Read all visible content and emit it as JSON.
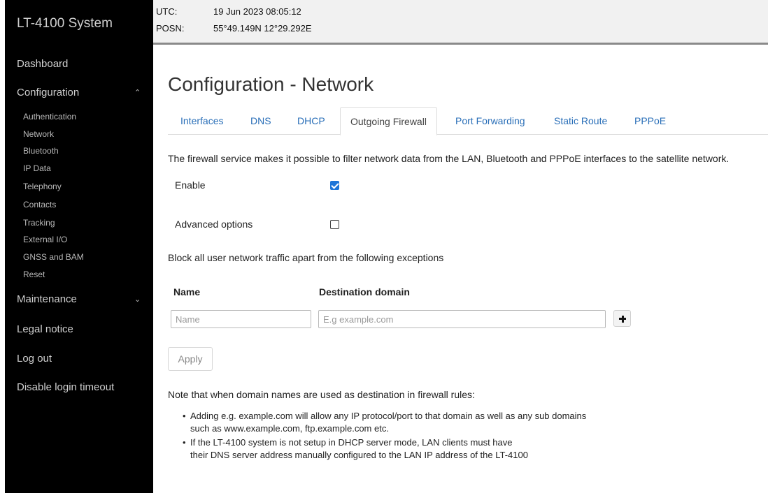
{
  "sidebar": {
    "brand": "LT-4100 System",
    "dashboard": "Dashboard",
    "configuration": "Configuration",
    "config_items": [
      "Authentication",
      "Network",
      "Bluetooth",
      "IP Data",
      "Telephony",
      "Contacts",
      "Tracking",
      "External I/O",
      "GNSS and BAM",
      "Reset"
    ],
    "maintenance": "Maintenance",
    "legal": "Legal notice",
    "logout": "Log out",
    "disable_timeout": "Disable login timeout"
  },
  "status": {
    "utc_label": "UTC:",
    "utc_value": "19 Jun 2023 08:05:12",
    "posn_label": "POSN:",
    "posn_value": "55°49.149N 12°29.292E"
  },
  "main": {
    "title": "Configuration - Network",
    "tabs": [
      "Interfaces",
      "DNS",
      "DHCP",
      "Outgoing Firewall",
      "Port Forwarding",
      "Static Route",
      "PPPoE"
    ],
    "active_tab": "Outgoing Firewall",
    "description": "The firewall service makes it possible to filter network data from the LAN, Bluetooth and PPPoE interfaces to the satellite network.",
    "enable_label": "Enable",
    "enable_checked": true,
    "advanced_label": "Advanced options",
    "advanced_checked": false,
    "block_text": "Block all user network traffic apart from the following exceptions",
    "col_name": "Name",
    "col_destination": "Destination domain",
    "name_placeholder": "Name",
    "domain_placeholder": "E.g example.com",
    "apply_label": "Apply",
    "note": "Note that when domain names are used as destination in firewall rules:",
    "bullet1_line1": "Adding e.g. example.com will allow any IP protocol/port to that domain as well as any sub domains",
    "bullet1_line2": "such as www.example.com, ftp.example.com etc.",
    "bullet2_line1": "If the LT-4100 system is not setup in DHCP server mode, LAN clients must have",
    "bullet2_line2": "their DNS server address manually configured to the LAN IP address of the LT-4100"
  }
}
